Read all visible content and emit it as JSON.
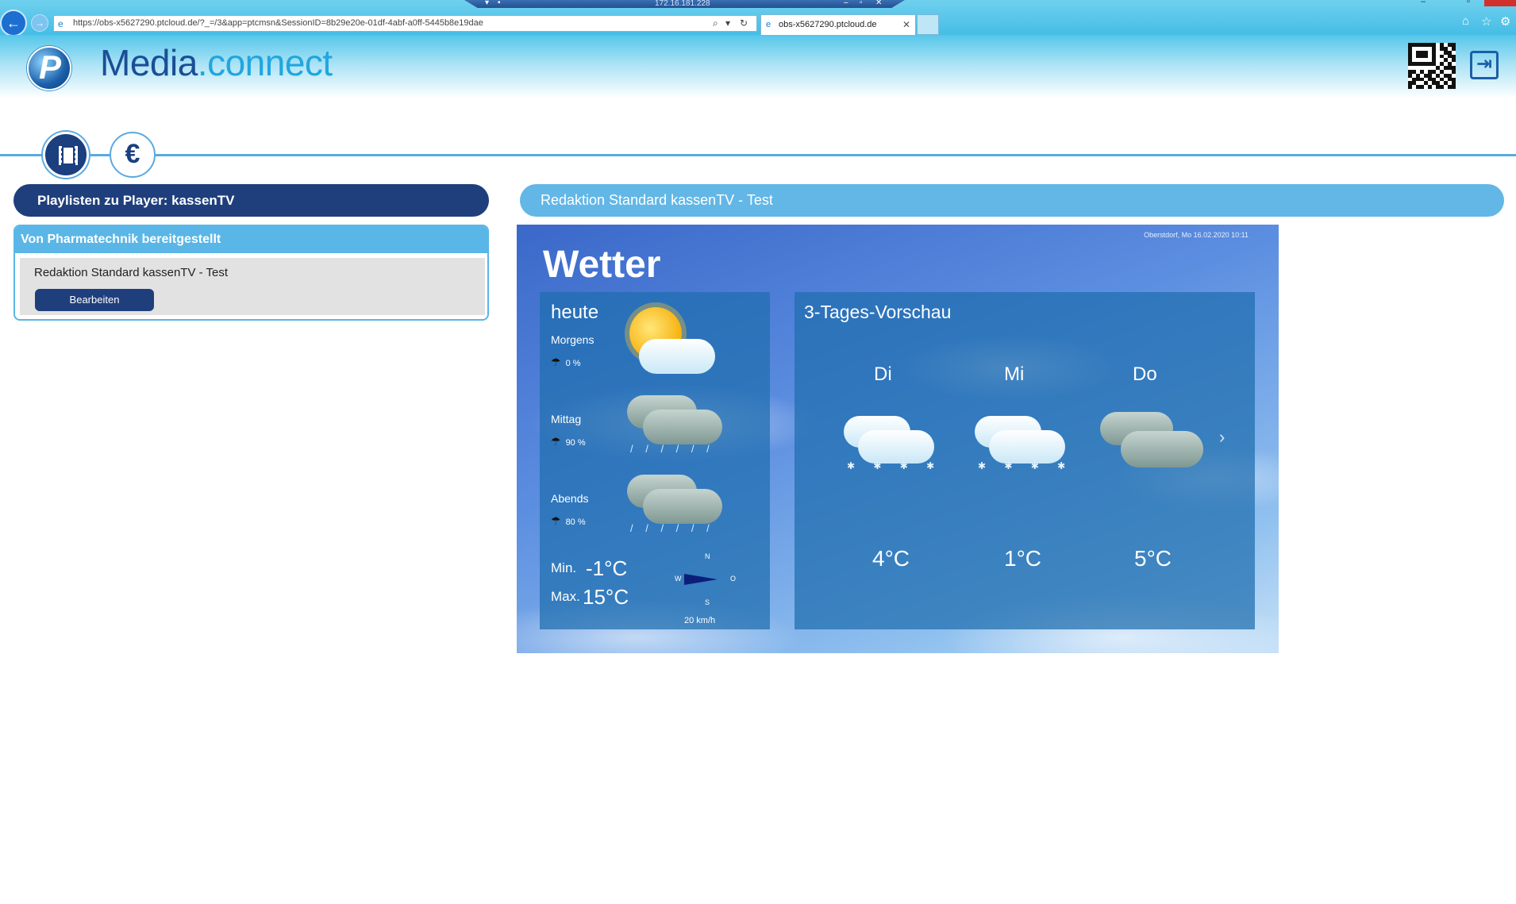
{
  "browser": {
    "rdp_ip": "172.16.181.228",
    "address": "https://obs-x5627290.ptcloud.de/?_=/3&app=ptcmsn&SessionID=8b29e20e-01df-4abf-a0ff-5445b8e19dae",
    "tab_title": "obs-x5627290.ptcloud.de"
  },
  "brand": {
    "part1": "Media",
    "part2": ".connect"
  },
  "left_panel": {
    "header": "Playlisten zu Player: kassenTV",
    "provider_title": "Von Pharmatechnik bereitgestellt",
    "playlist_name": "Redaktion Standard kassenTV - Test",
    "edit_label": "Bearbeiten"
  },
  "preview": {
    "header": "Redaktion Standard kassenTV - Test",
    "date_line": "Oberstdorf, Mo 16.02.2020 10:11",
    "title": "Wetter",
    "today": {
      "heading": "heute",
      "periods": [
        {
          "label": "Morgens",
          "rain": "0 %",
          "icon": "sun-cloud-icon"
        },
        {
          "label": "Mittag",
          "rain": "90 %",
          "icon": "rain-cloud-icon"
        },
        {
          "label": "Abends",
          "rain": "80 %",
          "icon": "rain-cloud-icon"
        }
      ],
      "min_label": "Min.",
      "min_value": "-1°C",
      "max_label": "Max.",
      "max_value": "15°C",
      "wind": {
        "n": "N",
        "w": "W",
        "o": "O",
        "s": "S",
        "speed": "20 km/h"
      }
    },
    "forecast": {
      "heading": "3-Tages-Vorschau",
      "days": [
        {
          "day": "Di",
          "temp": "4°C",
          "icon": "snow-cloud-icon"
        },
        {
          "day": "Mi",
          "temp": "1°C",
          "icon": "snow-cloud-icon"
        },
        {
          "day": "Do",
          "temp": "5°C",
          "icon": "grey-cloud-icon"
        }
      ]
    }
  }
}
